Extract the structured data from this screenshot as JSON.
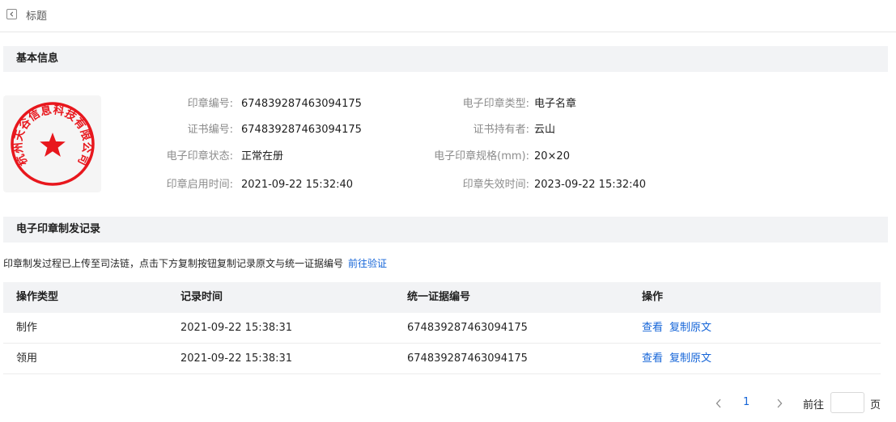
{
  "header": {
    "back_icon": "chevron-left-icon",
    "title": "标题"
  },
  "basic_info": {
    "section_title": "基本信息",
    "seal": {
      "ring_text": "杭州天谷信息科技有限公司",
      "star_icon": "star-icon",
      "color": "#e8171d"
    },
    "fields": [
      {
        "label": "印章编号:",
        "value": "674839287463094175"
      },
      {
        "label": "电子印章类型:",
        "value": "电子名章"
      },
      {
        "label": "证书编号:",
        "value": "674839287463094175"
      },
      {
        "label": "证书持有者:",
        "value": "云山"
      },
      {
        "label": "电子印章状态:",
        "value": "正常在册"
      },
      {
        "label": "电子印章规格(mm):",
        "value": "20×20"
      },
      {
        "label": "印章启用时间:",
        "value": "2021-09-22 15:32:40"
      },
      {
        "label": "印章失效时间:",
        "value": "2023-09-22 15:32:40"
      }
    ]
  },
  "records": {
    "section_title": "电子印章制发记录",
    "notice_text": "印章制发过程已上传至司法链，点击下方复制按钮复制记录原文与统一证据编号",
    "notice_link": "前往验证",
    "columns": [
      "操作类型",
      "记录时间",
      "统一证据编号",
      "操作"
    ],
    "rows": [
      {
        "type": "制作",
        "time": "2021-09-22 15:38:31",
        "evidence_id": "674839287463094175",
        "action_view": "查看",
        "action_copy": "复制原文"
      },
      {
        "type": "领用",
        "time": "2021-09-22 15:38:31",
        "evidence_id": "674839287463094175",
        "action_view": "查看",
        "action_copy": "复制原文"
      }
    ]
  },
  "pagination": {
    "prev_icon": "chevron-left-icon",
    "current_page": "1",
    "next_icon": "chevron-right-icon",
    "goto_label": "前往",
    "goto_value": "",
    "page_suffix": "页"
  },
  "colors": {
    "link": "#1565d8",
    "section_bg": "#f2f3f5",
    "seal_red": "#e8171d"
  }
}
